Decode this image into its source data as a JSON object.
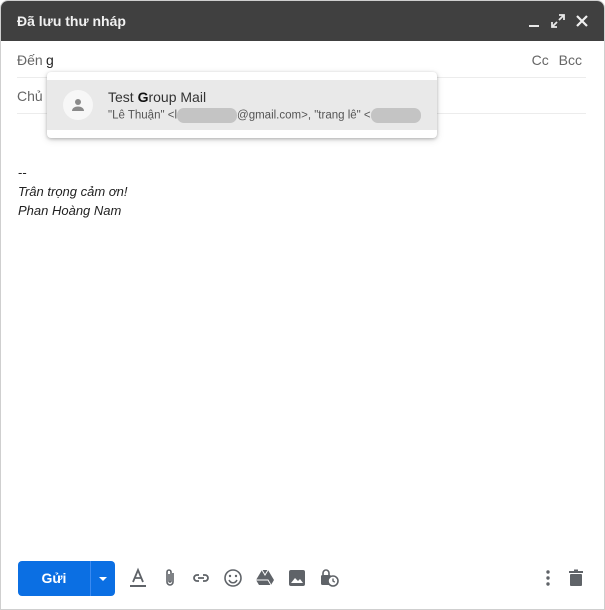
{
  "window": {
    "title": "Đã lưu thư nháp"
  },
  "titlebar": {
    "minimize_icon": "minimize-icon",
    "expand_icon": "expand-icon",
    "close_icon": "close-icon"
  },
  "to": {
    "label": "Đến",
    "value": "g",
    "cc": "Cc",
    "bcc": "Bcc"
  },
  "subject": {
    "label": "Chủ"
  },
  "suggestion": {
    "name_prefix": "Test ",
    "name_match": "G",
    "name_suffix": "roup Mail",
    "email_part1": "\"Lê Thuận\" <l",
    "email_part2": "@gmail.com>, \"trang lê\" <"
  },
  "body": {
    "separator": "--",
    "signature_line1": "Trân trọng cảm ơn!",
    "signature_line2": "Phan Hoàng Nam"
  },
  "toolbar": {
    "send_label": "Gửi",
    "accent_color": "#0b6fe3",
    "icons": [
      "format-text-icon",
      "attach-icon",
      "link-icon",
      "emoji-icon",
      "drive-icon",
      "photo-icon",
      "confidential-icon",
      "more-options-icon",
      "delete-icon"
    ]
  }
}
